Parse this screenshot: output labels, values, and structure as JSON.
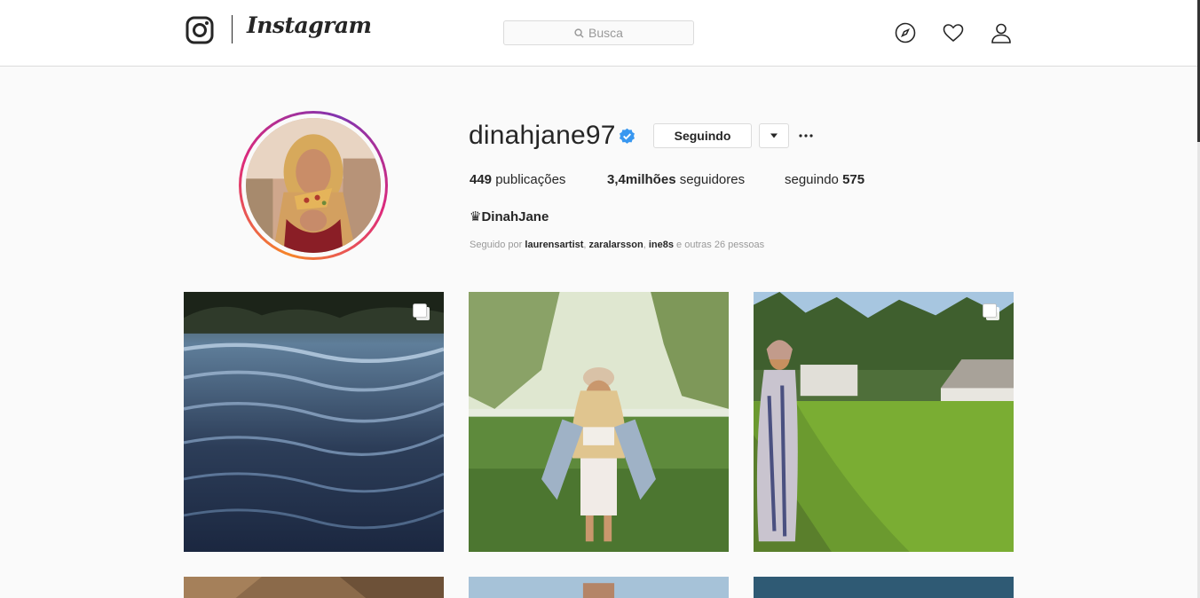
{
  "header": {
    "logo_icon": "instagram-camera-icon",
    "wordmark": "Instagram",
    "search_placeholder": "Busca",
    "nav_icons": [
      "compass-icon",
      "heart-icon",
      "person-icon"
    ]
  },
  "profile": {
    "username": "dinahjane97",
    "verified": true,
    "follow_button": "Seguindo",
    "stats": {
      "posts_count": "449",
      "posts_label": "publicações",
      "followers_count": "3,4milhões",
      "followers_label": "seguidores",
      "following_label": "seguindo",
      "following_count": "575"
    },
    "full_name": "♛DinahJane",
    "followed_by": {
      "prefix": "Seguido por",
      "users": [
        "laurensartist",
        "zaralarsson",
        "ine8s"
      ],
      "suffix": "e outras 26 pessoas"
    }
  },
  "colors": {
    "accent_blue": "#3897f0",
    "border": "#dbdbdb",
    "ring_orange": "#f58529",
    "ring_pink": "#dd2a7b"
  },
  "posts": [
    {
      "subject": "dark rippling water",
      "multi": true
    },
    {
      "subject": "woman in white outfit and denim jacket on grass",
      "multi": false
    },
    {
      "subject": "woman in striped dress by rice field",
      "multi": true
    },
    {
      "subject": "partial post",
      "multi": false
    },
    {
      "subject": "partial post",
      "multi": false
    },
    {
      "subject": "partial post",
      "multi": false
    }
  ]
}
